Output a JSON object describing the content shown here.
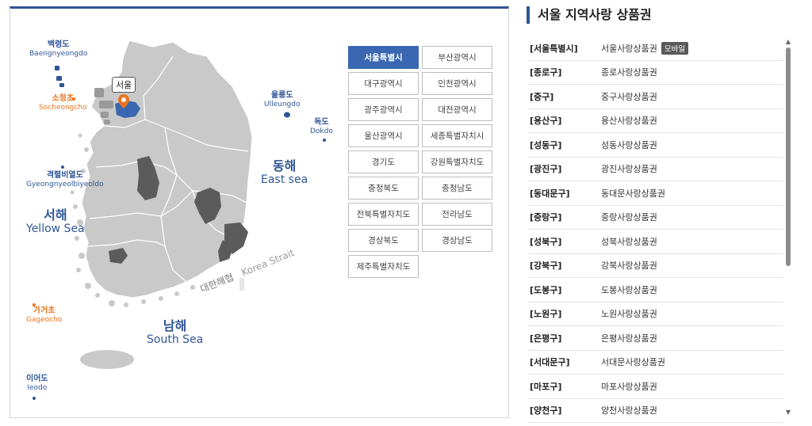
{
  "map": {
    "labels": {
      "baengnyeongdo": {
        "ko": "백령도",
        "en": "Baengnyeongdo"
      },
      "socheongcho": {
        "ko": "소청초",
        "en": "Socheongcho"
      },
      "gyeongnyeolbiyeoldo": {
        "ko": "격렬비열도",
        "en": "Gyeongnyeolbiyeoldo"
      },
      "yellow_sea": {
        "ko": "서해",
        "en": "Yellow Sea"
      },
      "gageocho": {
        "ko": "가거초",
        "en": "Gageocho"
      },
      "ieodo": {
        "ko": "이어도",
        "en": "Ieodo"
      },
      "ulleungdo": {
        "ko": "울릉도",
        "en": "Ulleungdo"
      },
      "dokdo": {
        "ko": "독도",
        "en": "Dokdo"
      },
      "east_sea": {
        "ko": "동해",
        "en": "East sea"
      },
      "south_sea": {
        "ko": "남해",
        "en": "South Sea"
      },
      "korea_strait": {
        "ko": "대한해협",
        "en": "Korea Strait"
      }
    },
    "selected_city_tag": "서울",
    "colors": {
      "land": "#c9c9c9",
      "highlight": "#5b5b5b",
      "selected": "#3a67b1",
      "pin": "#e8731e",
      "label_blue": "#2f5597",
      "label_orange": "#e8731e"
    }
  },
  "regions": [
    {
      "label": "서울특별시",
      "active": true
    },
    {
      "label": "부산광역시",
      "active": false
    },
    {
      "label": "대구광역시",
      "active": false
    },
    {
      "label": "인천광역시",
      "active": false
    },
    {
      "label": "광주광역시",
      "active": false
    },
    {
      "label": "대전광역시",
      "active": false
    },
    {
      "label": "울산광역시",
      "active": false
    },
    {
      "label": "세종특별자치시",
      "active": false
    },
    {
      "label": "경기도",
      "active": false
    },
    {
      "label": "강원특별자치도",
      "active": false
    },
    {
      "label": "충청북도",
      "active": false
    },
    {
      "label": "충청남도",
      "active": false
    },
    {
      "label": "전북특별자치도",
      "active": false
    },
    {
      "label": "전라남도",
      "active": false
    },
    {
      "label": "경상북도",
      "active": false
    },
    {
      "label": "경상남도",
      "active": false
    },
    {
      "label": "제주특별자치도",
      "active": false
    }
  ],
  "list": {
    "title": "서울 지역사랑 상품권",
    "mobile_badge": "모바일",
    "items": [
      {
        "district": "[서울특별시]",
        "name": "서울사랑상품권",
        "mobile": true
      },
      {
        "district": "[종로구]",
        "name": "종로사랑상품권"
      },
      {
        "district": "[중구]",
        "name": "중구사랑상품권"
      },
      {
        "district": "[용산구]",
        "name": "용산사랑상품권"
      },
      {
        "district": "[성동구]",
        "name": "성동사랑상품권"
      },
      {
        "district": "[광진구]",
        "name": "광진사랑상품권"
      },
      {
        "district": "[동대문구]",
        "name": "동대문사랑상품권"
      },
      {
        "district": "[중랑구]",
        "name": "중랑사랑상품권"
      },
      {
        "district": "[성북구]",
        "name": "성북사랑상품권"
      },
      {
        "district": "[강북구]",
        "name": "강북사랑상품권"
      },
      {
        "district": "[도봉구]",
        "name": "도봉사랑상품권"
      },
      {
        "district": "[노원구]",
        "name": "노원사랑상품권"
      },
      {
        "district": "[은평구]",
        "name": "은평사랑상품권"
      },
      {
        "district": "[서대문구]",
        "name": "서대문사랑상품권"
      },
      {
        "district": "[마포구]",
        "name": "마포사랑상품권"
      },
      {
        "district": "[양천구]",
        "name": "양천사랑상품권"
      }
    ]
  },
  "icons": {
    "scroll_up": "triangle-up-icon",
    "scroll_down": "triangle-down-icon",
    "pin": "map-pin-icon"
  }
}
